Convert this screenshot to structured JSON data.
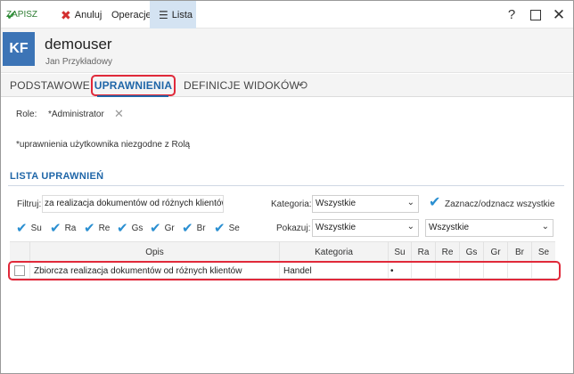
{
  "toolbar": {
    "save_label": "ZAPISZ",
    "cancel_label": "Anuluj",
    "operations_label": "Operacje",
    "list_label": "Lista"
  },
  "header": {
    "avatar_initials": "KF",
    "username": "demouser",
    "full_name": "Jan Przykładowy"
  },
  "tabs": [
    {
      "label": "PODSTAWOWE",
      "active": false
    },
    {
      "label": "UPRAWNIENIA",
      "active": true
    },
    {
      "label": "DEFINICJE WIDOKÓW",
      "active": false
    }
  ],
  "role": {
    "label": "Role:",
    "value": "*Administrator"
  },
  "note": "*uprawnienia użytkownika niezgodne z Rolą",
  "permissions_list": {
    "title": "LISTA UPRAWNIEŃ",
    "filter": {
      "label": "Filtruj:",
      "value": "za realizacja dokumentów od różnych klientów"
    },
    "category": {
      "label": "Kategoria:",
      "selected": "Wszystkie"
    },
    "toggle_all_label": "Zaznacz/odznacz wszystkie",
    "show": {
      "label": "Pokazuj:",
      "selected": "Wszystkie",
      "selected2": "Wszystkie"
    },
    "permission_checks": [
      {
        "label": "Su",
        "checked": true
      },
      {
        "label": "Ra",
        "checked": true
      },
      {
        "label": "Re",
        "checked": true
      },
      {
        "label": "Gs",
        "checked": true
      },
      {
        "label": "Gr",
        "checked": true
      },
      {
        "label": "Br",
        "checked": true
      },
      {
        "label": "Se",
        "checked": true
      }
    ],
    "columns": [
      "Opis",
      "Kategoria",
      "Su",
      "Ra",
      "Re",
      "Gs",
      "Gr",
      "Br",
      "Se"
    ],
    "rows": [
      {
        "opis": "Zbiorcza realizacja dokumentów od różnych klientów",
        "kategoria": "Handel",
        "su": "•",
        "ra": "",
        "re": "",
        "gs": "",
        "gr": "",
        "br": "",
        "se": ""
      }
    ]
  },
  "colors": {
    "accent": "#1f66a8",
    "highlight": "#e0293a",
    "avatar_bg": "#3c74b6",
    "check": "#2a8fd1"
  }
}
